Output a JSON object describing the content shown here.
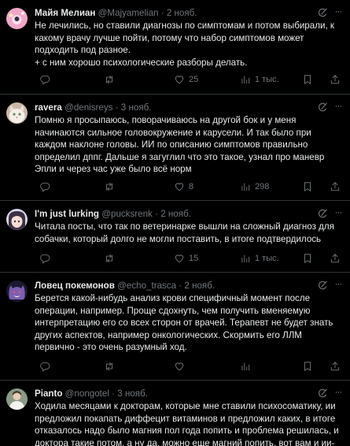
{
  "tweets": [
    {
      "name": "Майя Мелиан",
      "handle": "@Majyamelian",
      "separator": "·",
      "date": "2 нояб.",
      "avatar": "avatar-pink-stars",
      "text": "Не лечились, но ставили диагнозы по симптомам и потом выбирали, к какому врачу лучше пойти, потому что набор симптомов может подходить под разное.\n+ с ним хорошо психологические разборы делать.",
      "replies": "",
      "retweets": "",
      "likes": "25",
      "views": "1 тыс."
    },
    {
      "name": "ravera",
      "handle": "@denisreys",
      "separator": "·",
      "date": "3 нояб.",
      "avatar": "avatar-cat",
      "text": "Помню я просыпаюсь, поворачиваюсь на другой бок и у меня начинаются сильное головокружение и карусели. И так было при каждом наклоне головы. ИИ по описанию симптомов правильно определил дппг. Дальше я загуглил что это такое, узнал про маневр Эпли и через час уже было всё норм",
      "replies": "",
      "retweets": "",
      "likes": "8",
      "views": "298"
    },
    {
      "name": "I'm just lurking",
      "handle": "@pucksrenk",
      "separator": "·",
      "date": "2 нояб.",
      "avatar": "avatar-anime-girl",
      "text": "Читала посты, что так по ветеринарке вышли на сложный диагноз для собачки, который долго не могли поставить, в итоге подтвердилось",
      "replies": "",
      "retweets": "",
      "likes": "15",
      "views": "1 тыс."
    },
    {
      "name": "Ловец покемонов",
      "handle": "@echo_trasca",
      "separator": "·",
      "date": "2 нояб.",
      "avatar": "avatar-gengar",
      "text": "Берется какой-нибудь анализ крови специфичный момент после операции, например. Проще сдохнуть, чем получить вменяемую интерпретацию его со всех сторон от врачей. Терапевт не будет знать других аспектов, например онкологических. Скормить его ЛЛМ первично - это очень разумный ход.",
      "replies": "",
      "retweets": "",
      "likes": "",
      "views": ""
    },
    {
      "name": "Pianto",
      "handle": "@nongotel",
      "separator": "·",
      "date": "3 нояб.",
      "avatar": "avatar-person",
      "text": "Ходила месяцами к докторам, которые мне ставили психосоматику, ии предложил покапать диффецит витаминов и предложил каких, в итоге отказалось надо было магния пол года попить и проблема решилась, и доктора такие потом, а ну да, можно еще магний попить. вот вам и ии-",
      "replies": "",
      "retweets": "",
      "likes": "",
      "views": ""
    }
  ],
  "colors": {
    "background": "#000000",
    "text": "#e7e9ea",
    "secondary": "#71767b",
    "divider": "#2f3336"
  },
  "icons": [
    "reply-icon",
    "retweet-icon",
    "like-icon",
    "views-icon",
    "bookmark-icon",
    "share-icon",
    "grok-icon",
    "more-icon"
  ]
}
